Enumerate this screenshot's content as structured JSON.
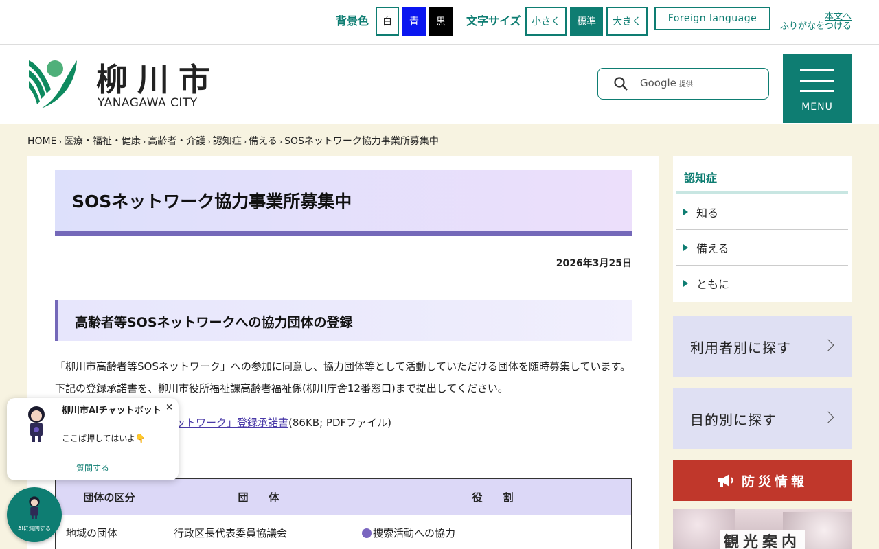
{
  "util": {
    "bg_label": "背景色",
    "bg_white": "白",
    "bg_blue": "青",
    "bg_black": "黒",
    "font_label": "文字サイズ",
    "font_small": "小さく",
    "font_standard": "標準",
    "font_large": "大きく",
    "foreign": "Foreign language",
    "furigana_line1": "本文へ",
    "furigana_line2": "ふりがなをつける"
  },
  "header": {
    "logo_jp": "柳川市",
    "logo_en": "YANAGAWA CITY",
    "search_brand": "Google",
    "search_suffix": "提供",
    "menu": "MENU"
  },
  "breadcrumb": [
    "HOME",
    "医療・福祉・健康",
    "高齢者・介護",
    "認知症",
    "備える",
    "SOSネットワーク協力事業所募集中"
  ],
  "main": {
    "title": "SOSネットワーク協力事業所募集中",
    "date": "2026年3月25日",
    "heading": "高齢者等SOSネットワークへの協力団体の登録",
    "paragraph": "「柳川市高齢者等SOSネットワーク」への参加に同意し、協力団体等として活動していただける団体を随時募集しています。下記の登録承諾書を、柳川市役所福祉課高齢者福祉係(柳川庁舎12番窓口)まで提出してください。",
    "pdf_link": "ットワーク」登録承諾書",
    "pdf_meta": "(86KB; PDFファイル)",
    "table": {
      "headers": [
        "団体の区分",
        "団　　体",
        "役　　割"
      ],
      "rows": [
        [
          "地域の団体",
          "行政区長代表委員協議会",
          "捜索活動への協力"
        ]
      ]
    }
  },
  "sidebar": {
    "category": "認知症",
    "items": [
      "知る",
      "備える",
      "ともに"
    ],
    "by_user": "利用者別に探す",
    "by_purpose": "目的別に探す",
    "disaster": "防災情報",
    "tourism": "観光案内"
  },
  "chat": {
    "title": "柳川市AIチャットボット",
    "subtitle": "ここば押してはいよ👇",
    "ask": "質問する",
    "close": "×",
    "fab": "AIに質問する"
  },
  "colors": {
    "accent": "#0e7d72",
    "purple": "#7468b9",
    "disaster": "#c0372b",
    "bg_cream": "#f7f3e1"
  }
}
